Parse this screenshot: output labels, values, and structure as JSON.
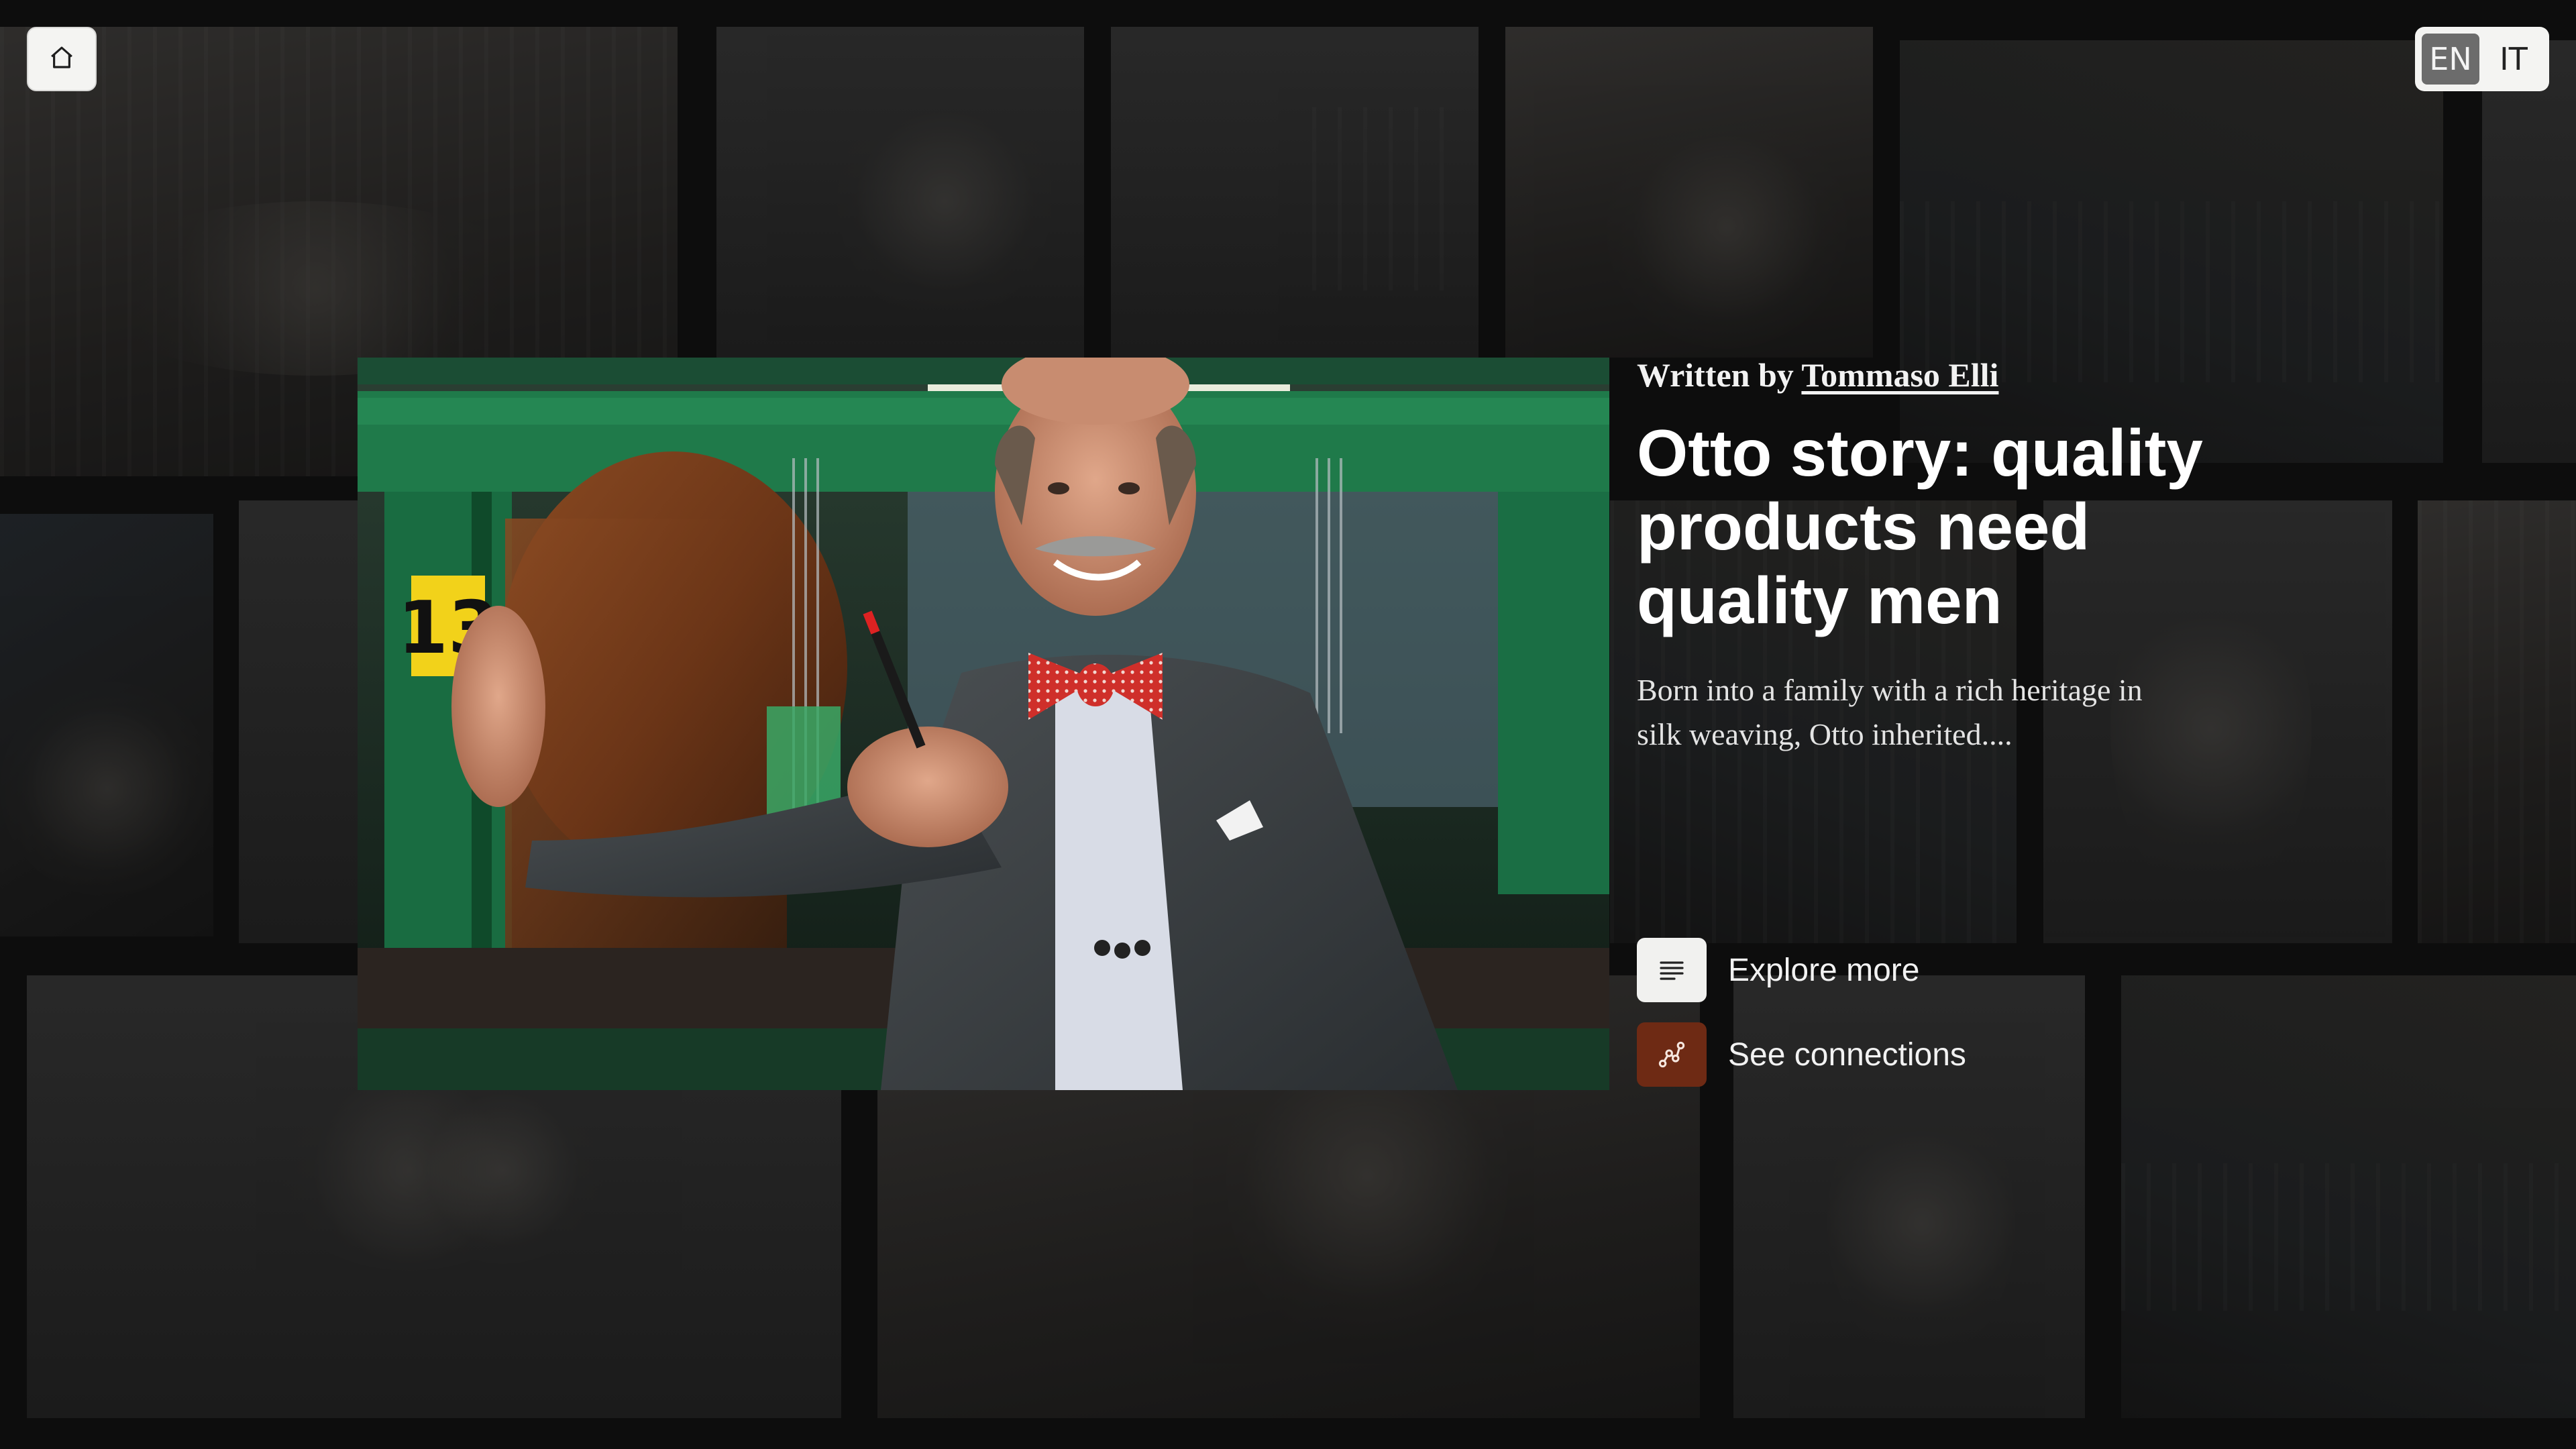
{
  "header": {
    "home_icon": "home-icon",
    "languages": [
      {
        "label": "EN",
        "active": true
      },
      {
        "label": "IT",
        "active": false
      }
    ]
  },
  "feature_photo": {
    "machine_tag": "13"
  },
  "article": {
    "byline_prefix": "Written by",
    "author": "Tommaso Elli",
    "title": "Otto story: quality products need quality men",
    "summary": "Born into a family with a rich heritage in silk weaving, Otto inherited....",
    "actions": [
      {
        "label": "Explore more",
        "icon": "lines-icon",
        "icon_bg": "#f1f1ef"
      },
      {
        "label": "See connections",
        "icon": "network-icon",
        "icon_bg": "#6e2a14"
      }
    ]
  },
  "colors": {
    "page_bg": "#0d0d0d",
    "accent": "#6e2a14",
    "text": "#ffffff"
  }
}
